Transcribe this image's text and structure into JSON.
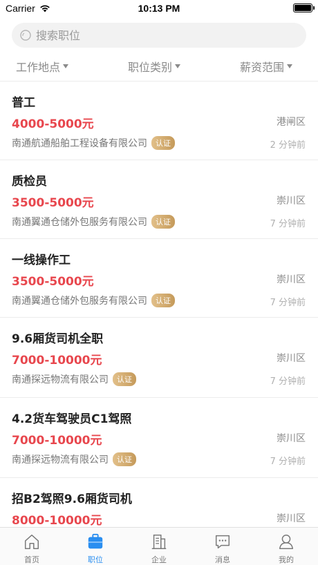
{
  "status_bar": {
    "carrier": "Carrier",
    "time": "10:13 PM",
    "battery_percent": 100
  },
  "search": {
    "placeholder": "搜索职位"
  },
  "filters": {
    "location": "工作地点",
    "category": "职位类别",
    "salary": "薪资范围"
  },
  "cert_label": "认证",
  "jobs": [
    {
      "title": "普工",
      "salary": "4000-5000元",
      "district": "港闸区",
      "company": "南通航通船舶工程设备有限公司",
      "time": "2 分钟前"
    },
    {
      "title": "质检员",
      "salary": "3500-5000元",
      "district": "崇川区",
      "company": "南通翼通仓储外包服务有限公司",
      "time": "7 分钟前"
    },
    {
      "title": "一线操作工",
      "salary": "3500-5000元",
      "district": "崇川区",
      "company": "南通翼通仓储外包服务有限公司",
      "time": "7 分钟前"
    },
    {
      "title": "9.6厢货司机全职",
      "salary": "7000-10000元",
      "district": "崇川区",
      "company": "南通探远物流有限公司",
      "time": "7 分钟前"
    },
    {
      "title": "4.2货车驾驶员C1驾照",
      "salary": "7000-10000元",
      "district": "崇川区",
      "company": "南通探远物流有限公司",
      "time": "7 分钟前"
    },
    {
      "title": "招B2驾照9.6厢货司机",
      "salary": "8000-10000元",
      "district": "崇川区",
      "company": "",
      "time": ""
    }
  ],
  "tabs": [
    {
      "label": "首页",
      "icon": "home-icon",
      "active": false
    },
    {
      "label": "职位",
      "icon": "briefcase-icon",
      "active": true
    },
    {
      "label": "企业",
      "icon": "building-icon",
      "active": false
    },
    {
      "label": "消息",
      "icon": "message-icon",
      "active": false
    },
    {
      "label": "我的",
      "icon": "user-icon",
      "active": false
    }
  ],
  "colors": {
    "salary": "#e8474e",
    "active_tab": "#2a8ef0",
    "badge": "#c59a5a"
  }
}
